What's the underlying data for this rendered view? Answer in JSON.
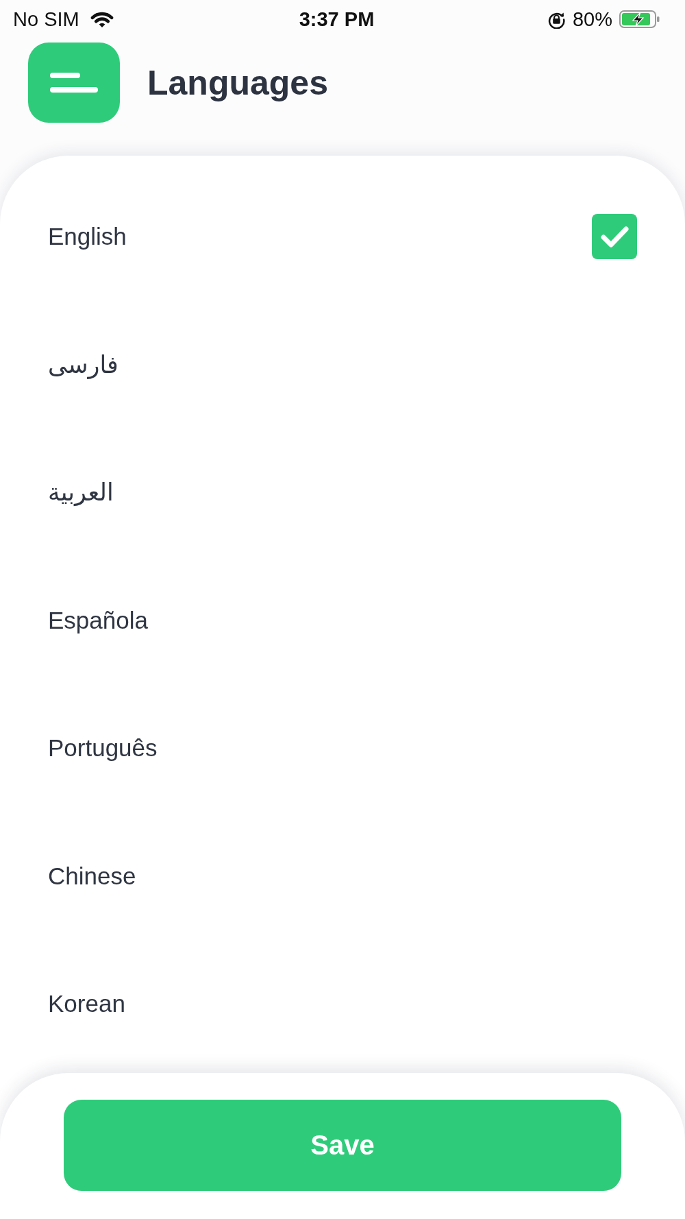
{
  "status_bar": {
    "carrier": "No SIM",
    "time": "3:37 PM",
    "battery": "80%"
  },
  "header": {
    "title": "Languages"
  },
  "languages": [
    {
      "label": "English",
      "selected": true
    },
    {
      "label": "فارسی",
      "selected": false
    },
    {
      "label": "العربية",
      "selected": false
    },
    {
      "label": "Española",
      "selected": false
    },
    {
      "label": "Português",
      "selected": false
    },
    {
      "label": "Chinese",
      "selected": false
    },
    {
      "label": "Korean",
      "selected": false
    }
  ],
  "save_button": {
    "label": "Save"
  }
}
